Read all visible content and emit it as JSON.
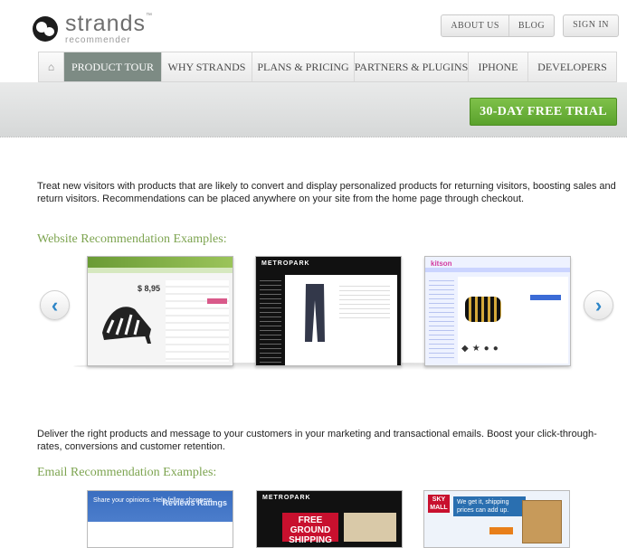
{
  "header": {
    "logo_name": "strands",
    "logo_tm": "™",
    "logo_sub": "recommender",
    "top_links": [
      "ABOUT US",
      "BLOG"
    ],
    "sign_in": "SIGN IN"
  },
  "nav": {
    "home_icon": "home-icon",
    "items": [
      {
        "label": "PRODUCT TOUR",
        "active": true
      },
      {
        "label": "WHY STRANDS",
        "active": false
      },
      {
        "label": "PLANS & PRICING",
        "active": false
      },
      {
        "label": "PARTNERS & PLUGINS",
        "active": false
      },
      {
        "label": "IPHONE",
        "active": false
      },
      {
        "label": "DEVELOPERS",
        "active": false
      }
    ]
  },
  "cta": {
    "trial_label": "30-DAY FREE TRIAL"
  },
  "website_section": {
    "intro": "Treat new visitors with products that are likely to convert and display personalized products for returning visitors, boosting sales and return visitors. Recommendations can be placed anywhere on your site from the home page through checkout.",
    "title": "Website Recommendation Examples:",
    "thumb1_price": "$ 8,95",
    "thumb2_brand": "METROPARK",
    "thumb3_brand": "kitson",
    "prev_arrow": "‹",
    "next_arrow": "›"
  },
  "email_section": {
    "intro": "Deliver the right products and message to your customers in your marketing and transactional emails. Boost your click-through-rates, conversions and customer retention.",
    "title": "Email Recommendation Examples:",
    "e1_text": "Share your opinions. Help fellow shoppers.",
    "e1_badge": "Reviews Ratings",
    "e2_brand": "METROPARK",
    "e2_free": "FREE GROUND SHIPPING",
    "e3_logo": "SKY MALL",
    "e3_msg": "We get it, shipping prices can add up."
  },
  "colors": {
    "accent_green": "#7da450",
    "trial_green": "#5aa22c",
    "nav_active": "#7d8b84",
    "arrow_blue": "#2e86c7"
  }
}
